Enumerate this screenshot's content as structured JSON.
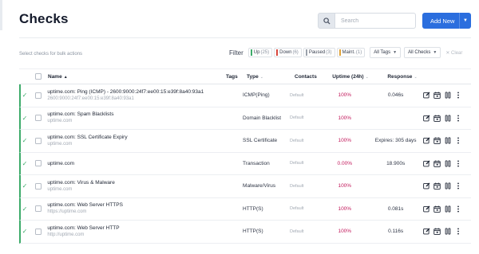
{
  "header": {
    "title": "Checks",
    "search_placeholder": "Search",
    "add_new_label": "Add New"
  },
  "toolbar": {
    "bulk_hint": "Select checks for bulk actions",
    "filter_label": "Filter",
    "chips": [
      {
        "label": "Up",
        "count": "(25)",
        "color": "#3dab6a"
      },
      {
        "label": "Down",
        "count": "(6)",
        "color": "#d9463b"
      },
      {
        "label": "Paused",
        "count": "(3)",
        "color": "#9aa1ab"
      },
      {
        "label": "Maint.",
        "count": "(1)",
        "color": "#e0a33a"
      }
    ],
    "all_tags": "All Tags",
    "all_checks": "All Checks",
    "clear": "✕ Clear"
  },
  "table": {
    "headers": {
      "name": "Name",
      "tags": "Tags",
      "type": "Type",
      "contacts": "Contacts",
      "uptime": "Uptime (24h)",
      "response": "Response"
    },
    "rows": [
      {
        "name": "uptime.com: Ping (ICMP) - 2600:9000:24f7:ee00:15:e39f:8a40:93a1",
        "sub": "2600:9000:24f7:ee00:15:e39f:8a40:93a1",
        "type": "ICMP(Ping)",
        "contacts": "Default",
        "uptime": "100%",
        "response": "0.046s"
      },
      {
        "name": "uptime.com: Spam Blacklists",
        "sub": "uptime.com",
        "type": "Domain Blacklist",
        "contacts": "Default",
        "uptime": "100%",
        "response": ""
      },
      {
        "name": "uptime.com: SSL Certificate Expiry",
        "sub": "uptime.com",
        "type": "SSL Certificate",
        "contacts": "Default",
        "uptime": "100%",
        "response": "Expires: 305 days"
      },
      {
        "name": "uptime.com",
        "sub": "",
        "type": "Transaction",
        "contacts": "Default",
        "uptime": "0.00%",
        "response": "18.900s"
      },
      {
        "name": "uptime.com: Virus & Malware",
        "sub": "uptime.com",
        "type": "Malware/Virus",
        "contacts": "Default",
        "uptime": "100%",
        "response": ""
      },
      {
        "name": "uptime.com: Web Server HTTPS",
        "sub": "https://uptime.com",
        "type": "HTTP(S)",
        "contacts": "Default",
        "uptime": "100%",
        "response": "0.081s"
      },
      {
        "name": "uptime.com: Web Server HTTP",
        "sub": "http://uptime.com",
        "type": "HTTP(S)",
        "contacts": "Default",
        "uptime": "100%",
        "response": "0.116s"
      }
    ]
  },
  "colors": {
    "accent": "#2b6ede",
    "status_up": "#3dab6a",
    "uptime_text": "#c2185b"
  }
}
